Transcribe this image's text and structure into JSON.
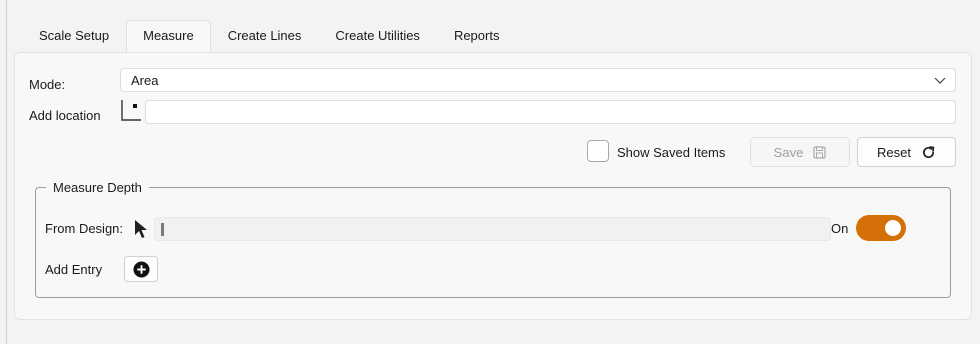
{
  "tabs": [
    {
      "label": "Scale Setup"
    },
    {
      "label": "Measure"
    },
    {
      "label": "Create Lines"
    },
    {
      "label": "Create Utilities"
    },
    {
      "label": "Reports"
    }
  ],
  "active_tab": "Measure",
  "form": {
    "mode_label": "Mode:",
    "mode_value": "Area",
    "add_location_label": "Add location",
    "add_location_value": "",
    "show_saved_label": "Show Saved Items",
    "show_saved_checked": false,
    "save_label": "Save",
    "reset_label": "Reset"
  },
  "measure_depth": {
    "legend": "Measure Depth",
    "from_design_label": "From Design:",
    "from_design_value": "",
    "toggle_label": "On",
    "toggle_on": true,
    "add_entry_label": "Add Entry"
  },
  "colors": {
    "accent": "#d56f08",
    "panel_bg": "#f8f8f8",
    "window_bg": "#f3f3f3"
  },
  "icons": {
    "mode_dropdown": "chevron-down-icon",
    "add_location": "pick-point-icon",
    "save": "floppy-disk-icon",
    "reset": "refresh-icon",
    "from_design": "cursor-arrow-icon",
    "add_entry": "plus-circle-icon"
  }
}
